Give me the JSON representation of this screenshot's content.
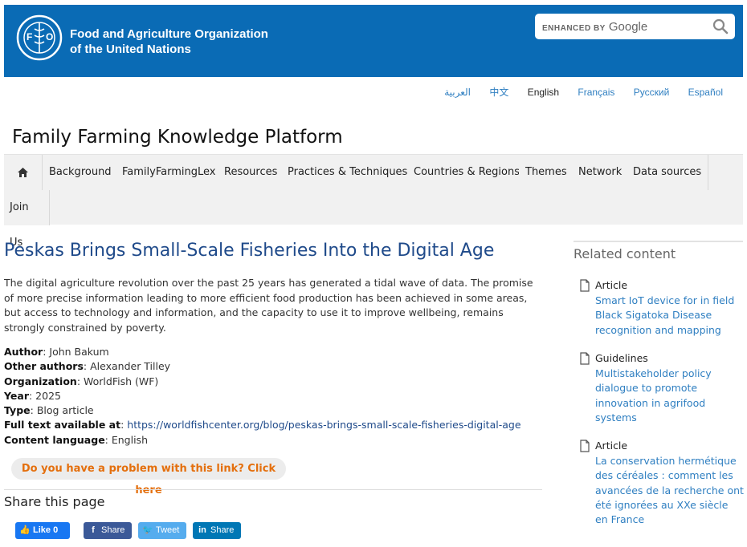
{
  "header": {
    "org_name_line1": "Food and Agriculture Organization",
    "org_name_line2": "of the United Nations",
    "logo_text": "FAO",
    "logo_motto": "FIAT PANIS",
    "search": {
      "enhanced_label": "ENHANCED BY",
      "provider": "Google",
      "icon": "search-icon"
    },
    "bg_color": "#0a6bb5"
  },
  "languages": [
    {
      "label": "العربية",
      "active": false
    },
    {
      "label": "中文",
      "active": false
    },
    {
      "label": "English",
      "active": true
    },
    {
      "label": "Français",
      "active": false
    },
    {
      "label": "Русский",
      "active": false
    },
    {
      "label": "Español",
      "active": false
    }
  ],
  "site_title": "Family Farming Knowledge Platform",
  "nav": {
    "home_icon": "home-icon",
    "items": [
      "Background",
      "FamilyFarmingLex",
      "Resources",
      "Practices & Techniques",
      "Countries & Regions",
      "Themes",
      "Network",
      "Data sources",
      "Join Us"
    ]
  },
  "article": {
    "title": "Peskas Brings Small-Scale Fisheries Into the Digital Age",
    "summary": "The digital agriculture revolution over the past 25 years has generated a tidal wave of data. The promise of more precise information leading to more efficient food production has been achieved in some areas, but access to technology and information, and the capacity to use it to improve wellbeing, remains strongly constrained by poverty.",
    "meta": {
      "author_label": "Author",
      "author": "John Bakum",
      "other_authors_label": "Other authors",
      "other_authors": "Alexander Tilley",
      "organization_label": "Organization",
      "organization": "WorldFish (WF)",
      "year_label": "Year",
      "year": "2025",
      "type_label": "Type",
      "type": "Blog article",
      "full_text_label": "Full text available at",
      "full_text_url": "https://worldfishcenter.org/blog/peskas-brings-small-scale-fisheries-digital-age",
      "content_language_label": "Content language",
      "content_language": "English"
    },
    "problem_link": "Do you have a problem with this link? Click here"
  },
  "share": {
    "title": "Share this page",
    "buttons": {
      "fb_like": "Like 0",
      "fb_share": "Share",
      "tweet": "Tweet",
      "linkedin": "Share"
    }
  },
  "related": {
    "title": "Related content",
    "items": [
      {
        "type": "Article",
        "link": "Smart IoT device for in field Black Sigatoka Disease recognition and mapping"
      },
      {
        "type": "Guidelines",
        "link": "Multistakeholder policy dialogue to promote innovation in agrifood systems"
      },
      {
        "type": "Article",
        "link": "La conservation hermétique des céréales : comment les avancées de la recherche ont été ignorées au XXe siècle en France"
      }
    ]
  }
}
